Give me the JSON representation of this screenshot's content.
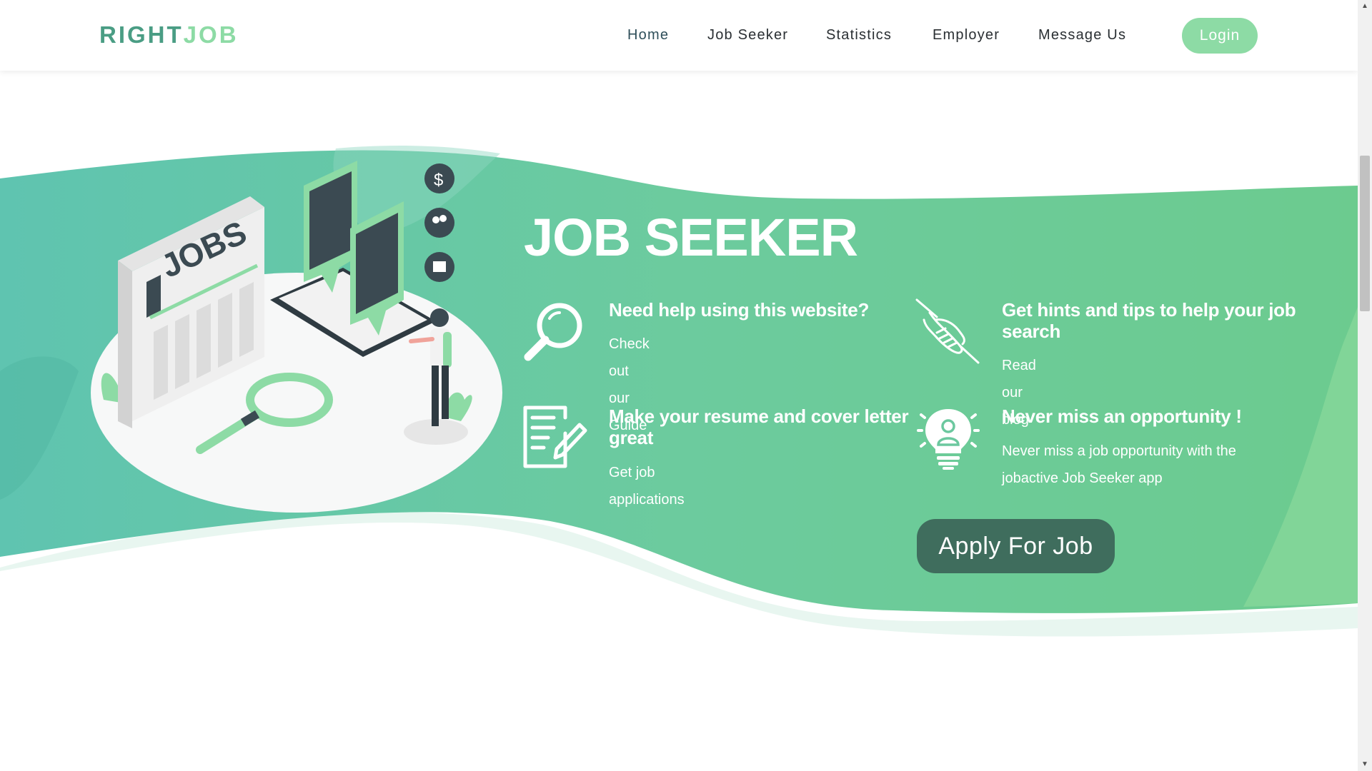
{
  "header": {
    "logo_part1": "RIGHT",
    "logo_part2": "JOB",
    "nav": [
      {
        "label": "Home"
      },
      {
        "label": "Job Seeker"
      },
      {
        "label": "Statistics"
      },
      {
        "label": "Employer"
      },
      {
        "label": "Message Us"
      }
    ],
    "login_label": "Login"
  },
  "hero": {
    "title": "JOB SEEKER",
    "illustration_label": "JOBS",
    "features": [
      {
        "heading": "Need help using this website?",
        "link": "Check out our Guide",
        "icon": "magnifier-icon"
      },
      {
        "heading": "Get hints and tips to help your job search",
        "link": "Read our blog",
        "icon": "handshake-icon"
      },
      {
        "heading": "Make your resume and cover letter great",
        "link": "Get job applications",
        "icon": "document-pen-icon"
      },
      {
        "heading": "Never miss an opportunity !",
        "link": "Never miss a job opportunity with the jobactive Job Seeker app",
        "icon": "lightbulb-person-icon"
      }
    ],
    "apply_label": "Apply For Job"
  },
  "colors": {
    "accent": "#8ddba5",
    "logo_dark": "#4a9d84",
    "wave_left": "#5fc4b0",
    "wave_right": "#6ccb8f",
    "apply_button": "#3f6d5d"
  }
}
